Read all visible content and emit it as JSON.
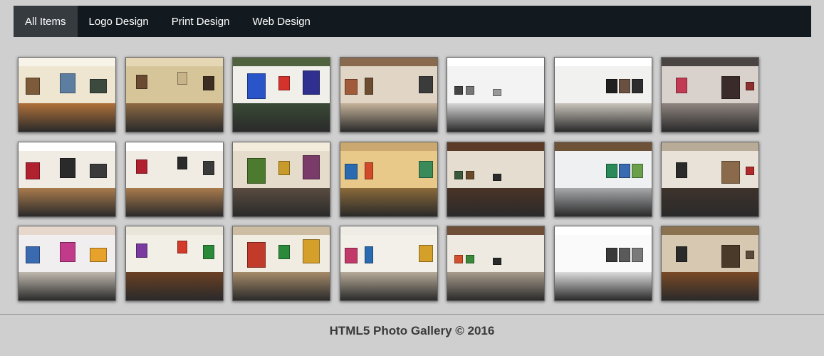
{
  "nav": {
    "items": [
      {
        "label": "All Items",
        "active": true
      },
      {
        "label": "Logo Design",
        "active": false
      },
      {
        "label": "Print Design",
        "active": false
      },
      {
        "label": "Web Design",
        "active": false
      }
    ]
  },
  "gallery": {
    "thumbnails": [
      {
        "wall": "#efe6d2",
        "floor": "#b0713a",
        "ceil": "#f7f3e8",
        "art": [
          "#7c5a3a",
          "#5d7ea0",
          "#3c4a3e"
        ]
      },
      {
        "wall": "#d7c59a",
        "floor": "#8d6a44",
        "ceil": "#e6d7b4",
        "art": [
          "#6a4a30",
          "#c9b48a",
          "#3d2c22"
        ]
      },
      {
        "wall": "#f0efe9",
        "floor": "#3a4a35",
        "ceil": "#50623e",
        "art": [
          "#2a55c8",
          "#d6322c",
          "#2f2f8f"
        ]
      },
      {
        "wall": "#e1d6c6",
        "floor": "#c5b29a",
        "ceil": "#8a6a4e",
        "art": [
          "#a15a3a",
          "#6d4d32",
          "#3b3b3b"
        ]
      },
      {
        "wall": "#f3f3f3",
        "floor": "#d6d6d6",
        "ceil": "#ffffff",
        "art": [
          "#444444",
          "#777777",
          "#999999"
        ]
      },
      {
        "wall": "#f1f1ef",
        "floor": "#c9c4bb",
        "ceil": "#ffffff",
        "art": [
          "#1f1f1f",
          "#6a5040",
          "#2d2d2d"
        ]
      },
      {
        "wall": "#d9d2cc",
        "floor": "#8f8580",
        "ceil": "#4a4442",
        "art": [
          "#c23b54",
          "#3b2a2a",
          "#8c2f2f"
        ]
      },
      {
        "wall": "#f0ece4",
        "floor": "#a97b4d",
        "ceil": "#ffffff",
        "art": [
          "#b1202e",
          "#2a2a2a",
          "#3a3a3a"
        ]
      },
      {
        "wall": "#f0ece4",
        "floor": "#a97b4d",
        "ceil": "#ffffff",
        "art": [
          "#b1202e",
          "#2a2a2a",
          "#3a3a3a"
        ]
      },
      {
        "wall": "#e6dccb",
        "floor": "#5a4c40",
        "ceil": "#f3ecdc",
        "art": [
          "#4c7a2e",
          "#c89a2a",
          "#7a3a6a"
        ]
      },
      {
        "wall": "#e8c98a",
        "floor": "#8a6a3a",
        "ceil": "#caa870",
        "art": [
          "#2a6ab0",
          "#d24a2a",
          "#3a8a5a"
        ]
      },
      {
        "wall": "#e5ddcf",
        "floor": "#4a3326",
        "ceil": "#5c3a28",
        "art": [
          "#3a5a3a",
          "#6a4a2a",
          "#2a2a2a"
        ]
      },
      {
        "wall": "#eef0f2",
        "floor": "#a7a9ab",
        "ceil": "#6e5238",
        "art": [
          "#2a8a5a",
          "#3a6ab0",
          "#6aa04a"
        ]
      },
      {
        "wall": "#e8e2d8",
        "floor": "#3e332c",
        "ceil": "#b8ab98",
        "art": [
          "#2a2a2a",
          "#8a6a4a",
          "#b02a2a"
        ]
      },
      {
        "wall": "#f1eef0",
        "floor": "#bfb8ae",
        "ceil": "#e6d8cc",
        "art": [
          "#3a6ab0",
          "#c23a8a",
          "#e6a22a"
        ]
      },
      {
        "wall": "#f2efe6",
        "floor": "#6b4024",
        "ceil": "#e9e5d9",
        "art": [
          "#7a3aa0",
          "#d43a2a",
          "#2a8a3a"
        ]
      },
      {
        "wall": "#f1ece2",
        "floor": "#a68b6a",
        "ceil": "#cdbda2",
        "art": [
          "#c23a2a",
          "#2a8a3a",
          "#d4a02a"
        ]
      },
      {
        "wall": "#f3f0ea",
        "floor": "#b7ab99",
        "ceil": "#efece6",
        "art": [
          "#c23a6a",
          "#2a6ab0",
          "#d4a02a"
        ]
      },
      {
        "wall": "#eeeae2",
        "floor": "#a89c8c",
        "ceil": "#6e4e36",
        "art": [
          "#d4502a",
          "#3a8a3a",
          "#2a2a2a"
        ]
      },
      {
        "wall": "#fafafa",
        "floor": "#dcdcdc",
        "ceil": "#ffffff",
        "art": [
          "#3a3a3a",
          "#5a5a5a",
          "#7a7a7a"
        ]
      },
      {
        "wall": "#d7c8b2",
        "floor": "#7a4a26",
        "ceil": "#8a7250",
        "art": [
          "#2a2a2a",
          "#4a3a2a",
          "#5a4a3a"
        ]
      }
    ]
  },
  "footer": {
    "text": "HTML5 Photo Gallery © 2016"
  }
}
